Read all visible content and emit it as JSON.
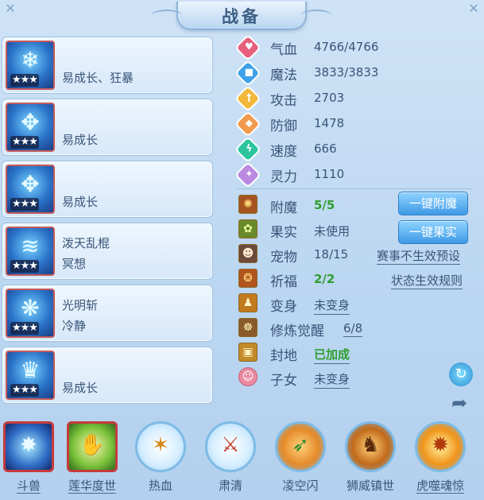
{
  "title": "战备",
  "cards": [
    {
      "line1": "",
      "line2": "易成长、狂暴",
      "stars": "★★★",
      "icon": "ice-dragon-icon"
    },
    {
      "line1": "",
      "line2": "易成长",
      "stars": "★★★",
      "icon": "frost-armor-icon"
    },
    {
      "line1": "",
      "line2": "易成长",
      "stars": "★★★",
      "icon": "frost-armor-icon"
    },
    {
      "line1": "泼天乱棍",
      "line2": "冥想",
      "stars": "★★★",
      "icon": "water-wave-icon"
    },
    {
      "line1": "光明斩",
      "line2": "冷静",
      "stars": "★★★",
      "icon": "ice-wing-icon"
    },
    {
      "line1": "",
      "line2": "易成长",
      "stars": "★★★",
      "icon": "ice-crown-icon"
    }
  ],
  "stats": [
    {
      "name": "气血",
      "value": "4766/4766",
      "color": "#e6607e",
      "icon": "heart-icon",
      "glyph": "♥"
    },
    {
      "name": "魔法",
      "value": "3833/3833",
      "color": "#3ea0e8",
      "icon": "mana-icon",
      "glyph": "■"
    },
    {
      "name": "攻击",
      "value": "2703",
      "color": "#f1b83a",
      "icon": "sword-icon",
      "glyph": "†"
    },
    {
      "name": "防御",
      "value": "1478",
      "color": "#f19a4e",
      "icon": "shield-icon",
      "glyph": "◆"
    },
    {
      "name": "速度",
      "value": "666",
      "color": "#2cc5a0",
      "icon": "lightning-icon",
      "glyph": "ϟ"
    },
    {
      "name": "灵力",
      "value": "1110",
      "color": "#b98ae0",
      "icon": "spirit-icon",
      "glyph": "✦"
    }
  ],
  "attrs": [
    {
      "name": "附魔",
      "value": "5/5",
      "style": "green",
      "icon": "enchant-icon",
      "glyph": "✺"
    },
    {
      "name": "果实",
      "value": "未使用",
      "style": "",
      "icon": "fruit-icon",
      "glyph": "✿"
    },
    {
      "name": "宠物",
      "value": "18/15",
      "style": "",
      "icon": "pet-portrait-icon",
      "glyph": "☻"
    },
    {
      "name": "祈福",
      "value": "2/2",
      "style": "green",
      "icon": "blessing-icon",
      "glyph": "❂"
    },
    {
      "name": "变身",
      "value": "未变身",
      "style": "uline",
      "icon": "transform-icon",
      "glyph": "♟"
    },
    {
      "name": "修炼觉醒",
      "value": "6/8",
      "style": "uline",
      "icon": "cultivation-icon",
      "glyph": "☸"
    },
    {
      "name": "封地",
      "value": "已加成",
      "style": "green uline",
      "icon": "fief-icon",
      "glyph": "▣"
    },
    {
      "name": "子女",
      "value": "未变身",
      "style": "uline",
      "icon": "child-icon",
      "glyph": "☺"
    }
  ],
  "buttons": {
    "enchant_all": "一键附魔",
    "fruit_all": "一键果实"
  },
  "links": {
    "preset": "赛事不生效预设",
    "rules": "状态生效规则"
  },
  "skills": [
    {
      "label": "斗兽",
      "icon": "beast-fight-icon",
      "glyph": "✸",
      "square": true,
      "underline": true
    },
    {
      "label": "莲华度世",
      "icon": "lotus-hand-icon",
      "glyph": "✋",
      "square": true,
      "underline": true
    },
    {
      "label": "热血",
      "icon": "hot-blood-icon",
      "glyph": "✶",
      "square": false,
      "underline": false
    },
    {
      "label": "肃清",
      "icon": "purge-blade-icon",
      "glyph": "⚔",
      "square": false,
      "underline": false
    },
    {
      "label": "凌空闪",
      "icon": "air-flash-icon",
      "glyph": "➶",
      "square": false,
      "underline": false
    },
    {
      "label": "狮威镇世",
      "icon": "lion-might-icon",
      "glyph": "♞",
      "square": false,
      "underline": false
    },
    {
      "label": "虎噬魂惊",
      "icon": "tiger-devour-icon",
      "glyph": "✹",
      "square": false,
      "underline": true
    }
  ]
}
